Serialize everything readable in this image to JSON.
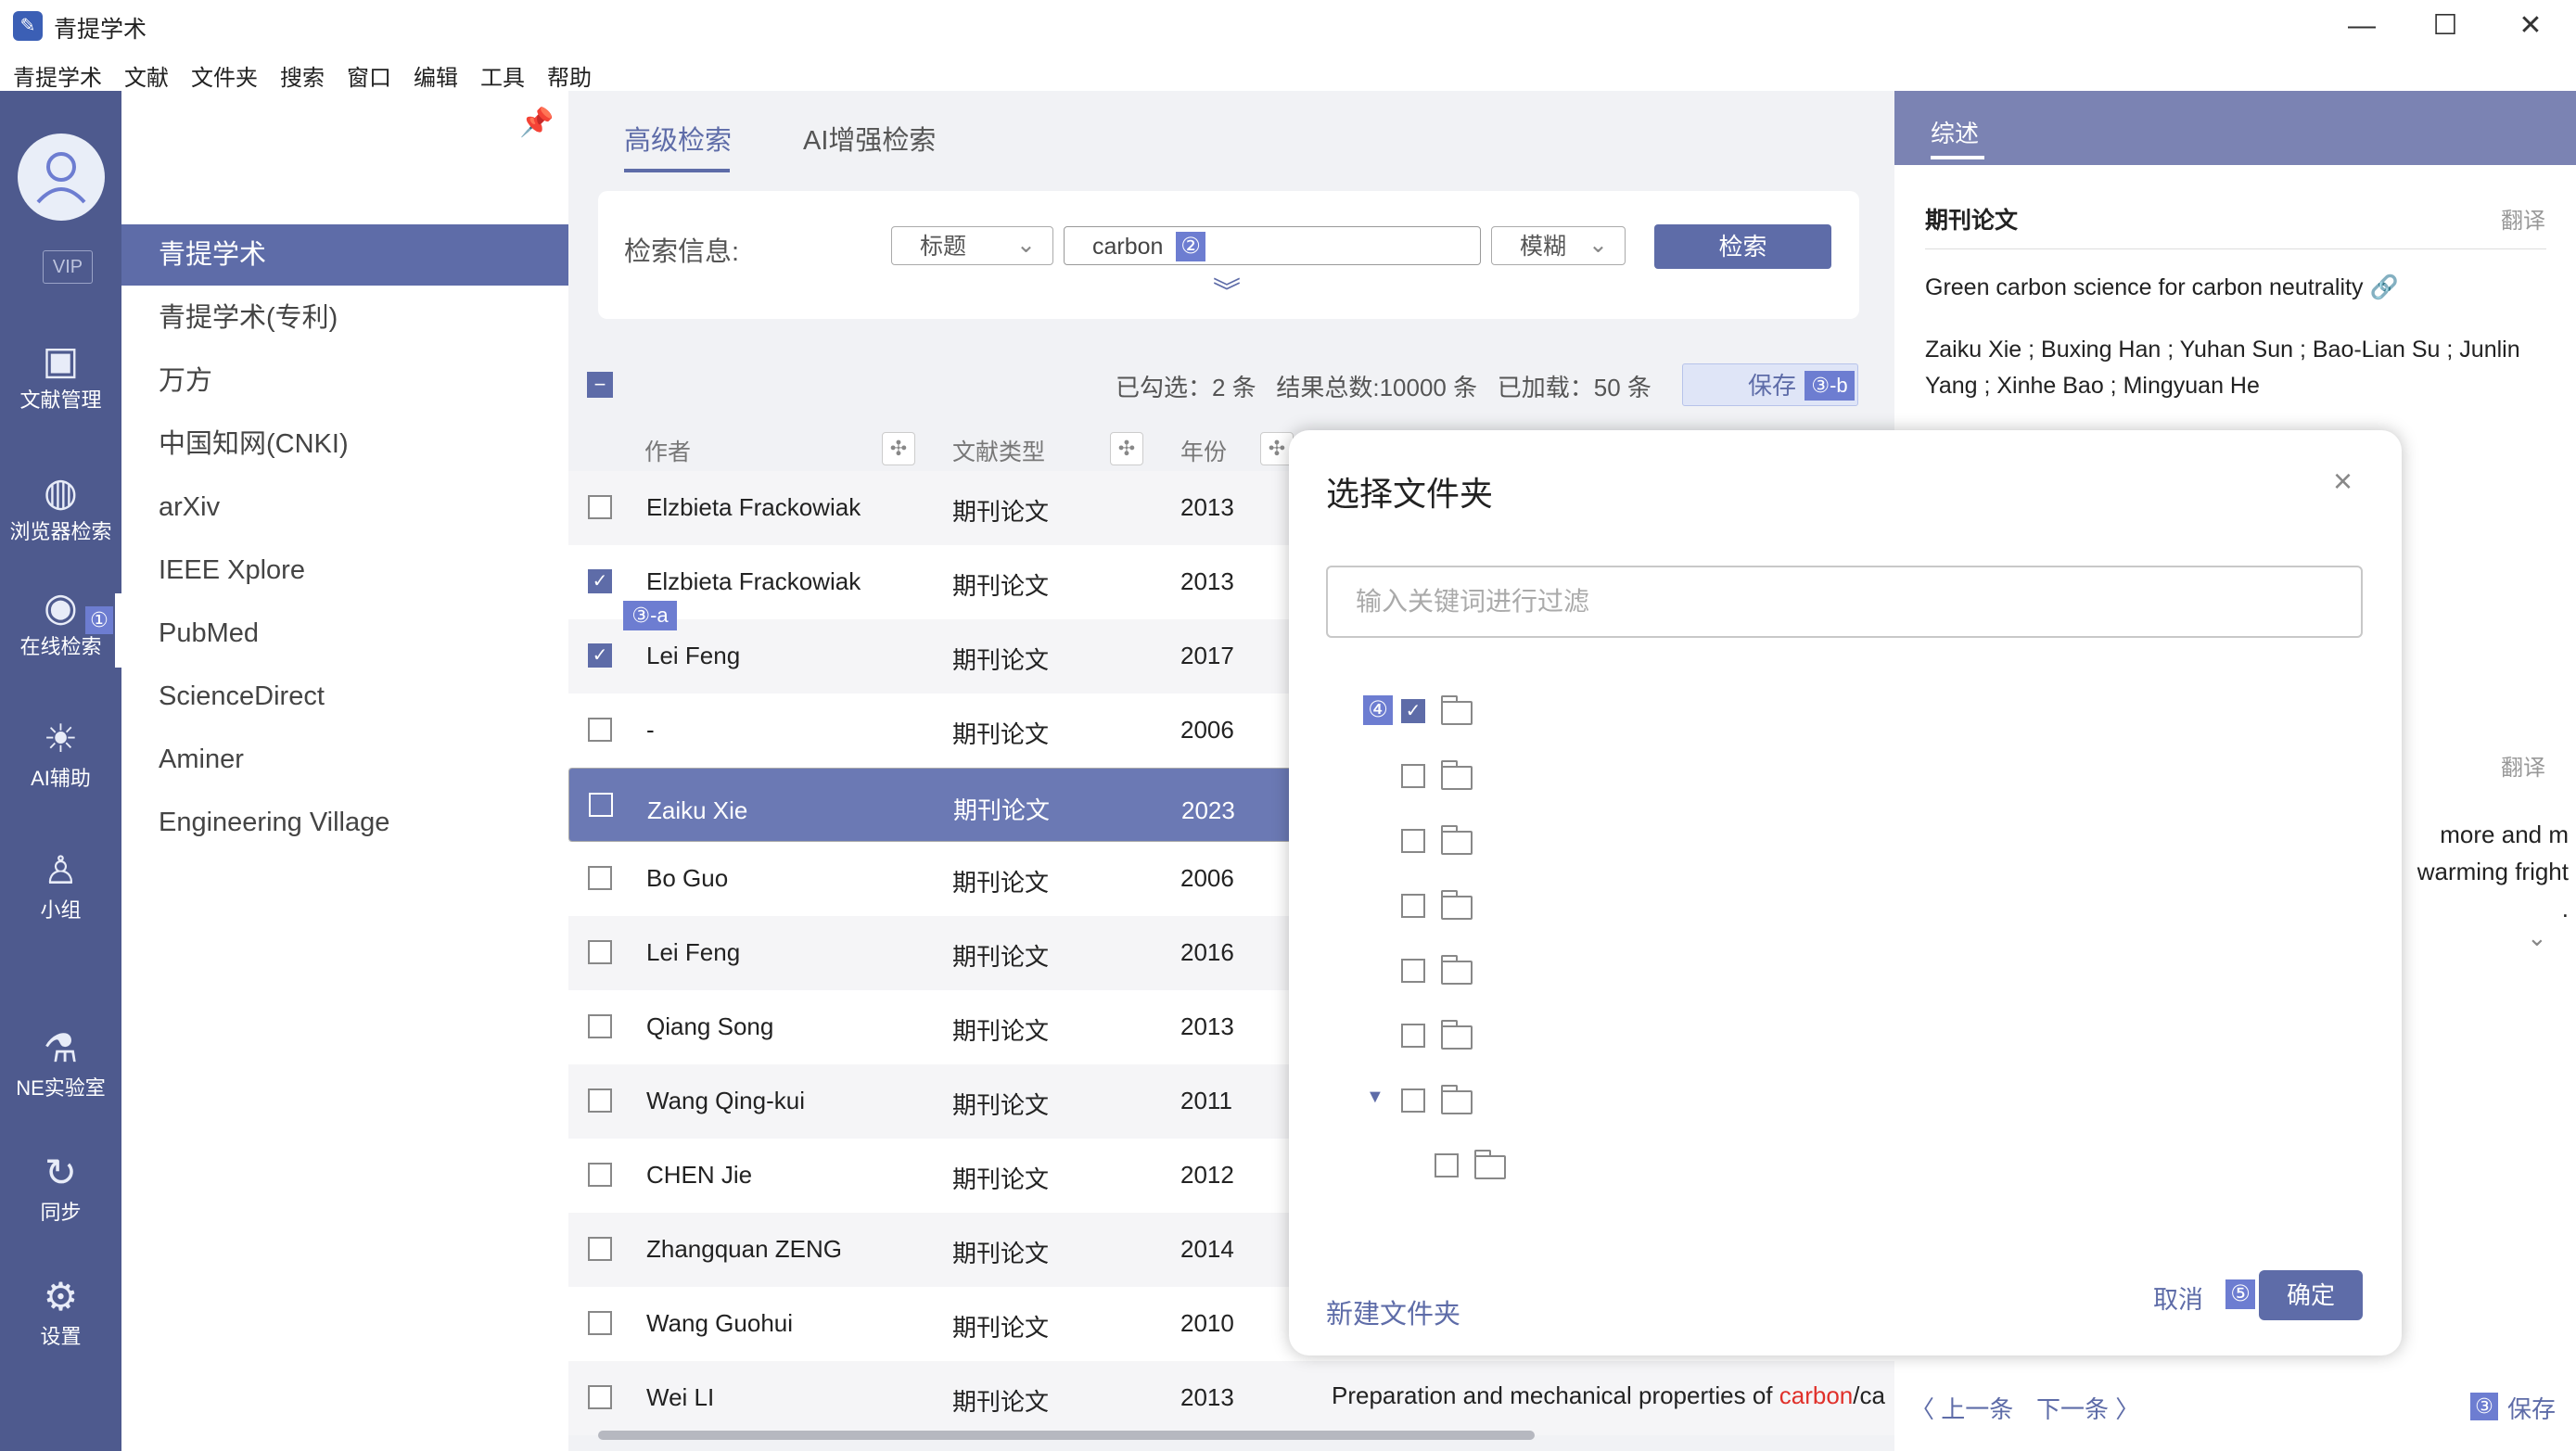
{
  "window": {
    "title": "青提学术",
    "minimize": "—",
    "maximize": "☐",
    "close": "✕"
  },
  "menu": [
    "青提学术",
    "文献",
    "文件夹",
    "搜索",
    "窗口",
    "编辑",
    "工具",
    "帮助"
  ],
  "rail": {
    "vip": "VIP",
    "items": [
      {
        "label": "文献管理",
        "icon": "box-icon"
      },
      {
        "label": "浏览器检索",
        "icon": "globe-icon"
      },
      {
        "label": "在线检索",
        "icon": "eye-icon"
      },
      {
        "label": "AI辅助",
        "icon": "bulb-icon"
      },
      {
        "label": "小组",
        "icon": "group-icon"
      },
      {
        "label": "NE实验室",
        "icon": "microscope-icon"
      },
      {
        "label": "同步",
        "icon": "sync-icon"
      },
      {
        "label": "设置",
        "icon": "gear-icon"
      }
    ],
    "badge": "①"
  },
  "sources": [
    "青提学术",
    "青提学术(专利)",
    "万方",
    "中国知网(CNKI)",
    "arXiv",
    "IEEE Xplore",
    "PubMed",
    "ScienceDirect",
    "Aminer",
    "Engineering Village"
  ],
  "tabs": [
    "高级检索",
    "AI增强检索"
  ],
  "search": {
    "label": "检索信息:",
    "field": "标题",
    "query": "carbon",
    "mode": "模糊",
    "button": "检索",
    "badge": "②"
  },
  "stats": {
    "selected": "已勾选：2 条",
    "total": "结果总数:10000 条",
    "loaded": "已加载：50 条",
    "save": "保存",
    "badge": "③-b"
  },
  "table": {
    "headers": {
      "author": "作者",
      "type": "文献类型",
      "year": "年份"
    },
    "badge": "③-a",
    "rows": [
      {
        "author": "Elzbieta Frackowiak",
        "type": "期刊论文",
        "year": "2013"
      },
      {
        "author": "Elzbieta Frackowiak",
        "type": "期刊论文",
        "year": "2013"
      },
      {
        "author": "Lei Feng",
        "type": "期刊论文",
        "year": "2017"
      },
      {
        "author": "-",
        "type": "期刊论文",
        "year": "2006"
      },
      {
        "author": "Zaiku Xie",
        "type": "期刊论文",
        "year": "2023"
      },
      {
        "author": "Bo Guo",
        "type": "期刊论文",
        "year": "2006"
      },
      {
        "author": "Lei Feng",
        "type": "期刊论文",
        "year": "2016"
      },
      {
        "author": "Qiang Song",
        "type": "期刊论文",
        "year": "2013"
      },
      {
        "author": "Wang Qing-kui",
        "type": "期刊论文",
        "year": "2011"
      },
      {
        "author": "CHEN Jie",
        "type": "期刊论文",
        "year": "2012"
      },
      {
        "author": "Zhangquan ZENG",
        "type": "期刊论文",
        "year": "2014"
      },
      {
        "author": "Wang Guohui",
        "type": "期刊论文",
        "year": "2010"
      },
      {
        "author": "Wei LI",
        "type": "期刊论文",
        "year": "2013"
      }
    ],
    "last_title_prefix": "Preparation and mechanical properties of ",
    "last_title_highlight": "carbon",
    "last_title_suffix": "/ca"
  },
  "detail": {
    "tab": "综述",
    "type": "期刊论文",
    "translate": "翻译",
    "title": "Green carbon science for carbon neutrality",
    "authors": "Zaiku Xie ; Buxing Han ; Yuhan Sun ; Bao-Lian Su ; Junlin Yang ; Xinhe Bao ; Mingyuan He",
    "snippet": " more and m\nwarming fright\n.",
    "prev": "〈 上一条",
    "next": "下一条 〉",
    "save": "保存",
    "badge": "③"
  },
  "modal": {
    "title": "选择文件夹",
    "filter_placeholder": "输入关键词进行过滤",
    "new_folder": "新建文件夹",
    "cancel": "取消",
    "ok": "确定",
    "badge_tree": "④",
    "badge_ok": "⑤"
  }
}
